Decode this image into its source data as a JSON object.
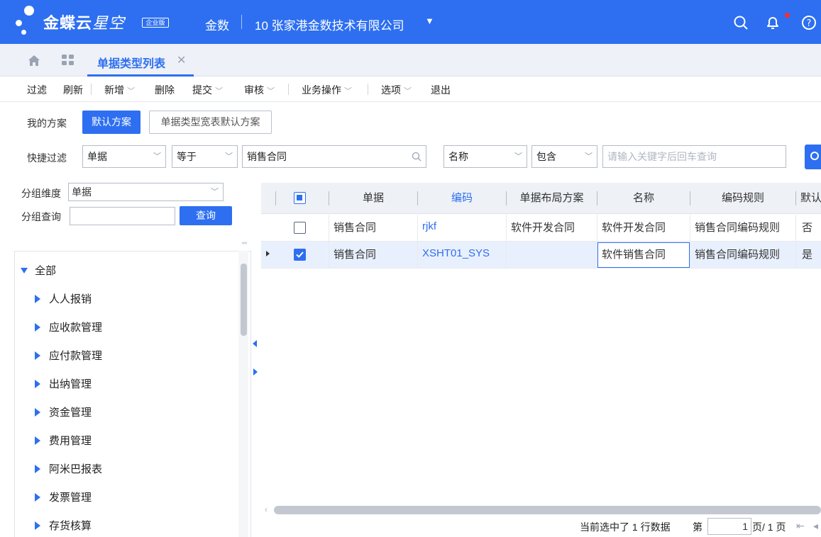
{
  "header": {
    "logo_main": "金蝶云",
    "logo_sub": "星空",
    "logo_badge": "企业版",
    "product": "金数",
    "org": "10 张家港金数技术有限公司"
  },
  "tabs": {
    "active_label": "单据类型列表"
  },
  "toolbar": {
    "filter": "过滤",
    "refresh": "刷新",
    "add": "新增",
    "delete": "删除",
    "submit": "提交",
    "audit": "审核",
    "business_ops": "业务操作",
    "options": "选项",
    "exit": "退出"
  },
  "scheme": {
    "label": "我的方案",
    "default": "默认方案",
    "wide": "单据类型宽表默认方案"
  },
  "quick_filter": {
    "label": "快捷过滤",
    "field1": "单据",
    "op1": "等于",
    "value1": "销售合同",
    "field2": "名称",
    "op2": "包含",
    "value2_placeholder": "请输入关键字后回车查询"
  },
  "group": {
    "dimension_label": "分组维度",
    "dimension_value": "单据",
    "query_label": "分组查询",
    "query_button": "查询"
  },
  "tree": {
    "root": "全部",
    "items": [
      "人人报销",
      "应收款管理",
      "应付款管理",
      "出纳管理",
      "资金管理",
      "费用管理",
      "阿米巴报表",
      "发票管理",
      "存货核算"
    ]
  },
  "grid": {
    "columns": [
      "单据",
      "编码",
      "单据布局方案",
      "名称",
      "编码规则",
      "默认"
    ],
    "rows": [
      {
        "bill": "销售合同",
        "code": "rjkf",
        "layout": "软件开发合同",
        "name": "软件开发合同",
        "rule": "销售合同编码规则",
        "default": "否",
        "checked": false
      },
      {
        "bill": "销售合同",
        "code": "XSHT01_SYS",
        "layout": "",
        "name": "软件销售合同",
        "rule": "销售合同编码规则",
        "default": "是",
        "checked": true
      }
    ]
  },
  "footer": {
    "selected_text": "当前选中了 1 行数据",
    "page_prefix": "第",
    "page_value": "1",
    "page_suffix": "页/ 1 页"
  },
  "colors": {
    "primary": "#2d6ff0",
    "header_bg": "#2d6ff0",
    "tabbar_bg": "#eef1f7"
  }
}
